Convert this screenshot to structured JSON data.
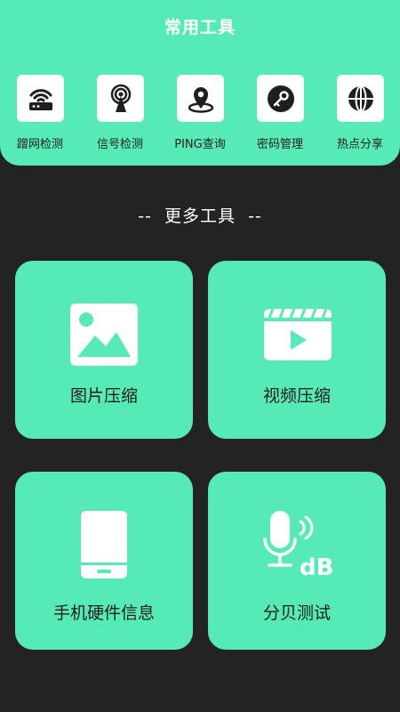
{
  "header": {
    "title": "常用工具"
  },
  "quick_tools": [
    {
      "label": "蹭网检测",
      "icon": "router-icon"
    },
    {
      "label": "信号检测",
      "icon": "signal-tower-icon"
    },
    {
      "label": "PING查询",
      "icon": "location-pin-icon"
    },
    {
      "label": "密码管理",
      "icon": "key-icon"
    },
    {
      "label": "热点分享",
      "icon": "globe-icon"
    }
  ],
  "more_tools": {
    "title": "--  更多工具  --",
    "cards": [
      {
        "label": "图片压缩",
        "icon": "image-icon"
      },
      {
        "label": "视频压缩",
        "icon": "video-icon"
      },
      {
        "label": "手机硬件信息",
        "icon": "phone-icon"
      },
      {
        "label": "分贝测试",
        "icon": "microphone-db-icon"
      }
    ]
  },
  "colors": {
    "accent": "#56eab7",
    "background": "#232323",
    "icon_dark": "#1f1f1f",
    "white": "#ffffff"
  }
}
